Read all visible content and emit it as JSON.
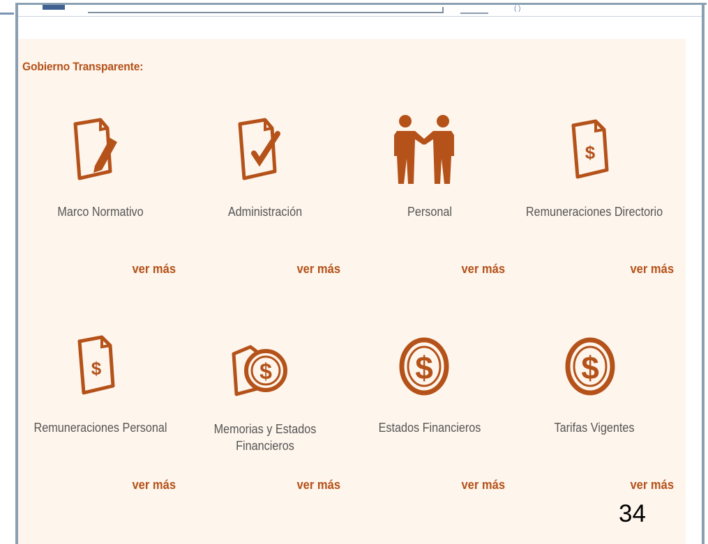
{
  "section": {
    "title": "Gobierno Transparente:"
  },
  "items": [
    {
      "label": "Marco Normativo",
      "more": "ver más",
      "icon": "document-pencil-icon"
    },
    {
      "label": "Administración",
      "more": "ver más",
      "icon": "document-check-icon"
    },
    {
      "label": "Personal",
      "more": "ver más",
      "icon": "handshake-people-icon"
    },
    {
      "label": "Remuneraciones Directorio",
      "more": "ver más",
      "icon": "document-dollar-icon"
    },
    {
      "label": "Remuneraciones Personal",
      "more": "ver más",
      "icon": "document-dollar-icon"
    },
    {
      "label": "Memorias y Estados Financieros",
      "more": "ver más",
      "icon": "document-coin-icon"
    },
    {
      "label": "Estados Financieros",
      "more": "ver más",
      "icon": "dollar-coin-icon"
    },
    {
      "label": "Tarifas Vigentes",
      "more": "ver más",
      "icon": "dollar-coin-icon"
    }
  ],
  "slide_number": "34",
  "colors": {
    "accent": "#b4521a",
    "panel_bg": "#fef5ec",
    "label_text": "#555555"
  }
}
